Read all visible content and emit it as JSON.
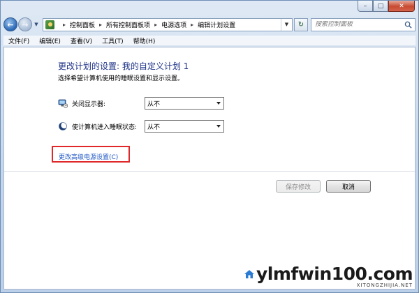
{
  "window": {
    "caption": {
      "minimize": "–",
      "maximize": "□",
      "close": "✕"
    }
  },
  "nav": {
    "back_icon": "back-arrow-icon",
    "forward_icon": "forward-arrow-icon",
    "breadcrumbs": [
      "控制面板",
      "所有控制面板项",
      "电源选项",
      "编辑计划设置"
    ],
    "search": {
      "placeholder": "搜索控制面板"
    }
  },
  "menu": {
    "items": [
      "文件(F)",
      "编辑(E)",
      "查看(V)",
      "工具(T)",
      "帮助(H)"
    ]
  },
  "main": {
    "title": "更改计划的设置: 我的自定义计划 1",
    "subtitle": "选择希望计算机使用的睡眠设置和显示设置。",
    "settings": [
      {
        "label": "关闭显示器:",
        "value": "从不",
        "icon": "monitor-icon"
      },
      {
        "label": "使计算机进入睡眠状态:",
        "value": "从不",
        "icon": "moon-sleep-icon"
      }
    ],
    "advanced_link": "更改高级电源设置(C)",
    "save_button": "保存修改",
    "cancel_button": "取消"
  },
  "watermark": {
    "main": "ylmfwin100.com",
    "sub": "XITONGZHIJIA.NET"
  },
  "colors": {
    "title": "#1e3287",
    "link": "#1f57c4",
    "highlight_box": "#e0282a"
  }
}
